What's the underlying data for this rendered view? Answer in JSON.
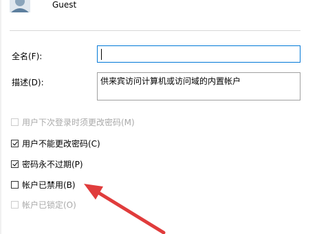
{
  "user": {
    "name": "Guest",
    "avatar_icon": "user-avatar-icon"
  },
  "form": {
    "fullname_label": "全名(F):",
    "fullname_value": "",
    "description_label": "描述(D):",
    "description_value": "供来宾访问计算机或访问域的内置帐户"
  },
  "options": [
    {
      "label": "用户下次登录时须更改密码(M)",
      "checked": false,
      "enabled": false
    },
    {
      "label": "用户不能更改密码(C)",
      "checked": true,
      "enabled": true
    },
    {
      "label": "密码永不过期(P)",
      "checked": true,
      "enabled": true
    },
    {
      "label": "帐户已禁用(B)",
      "checked": false,
      "enabled": true
    },
    {
      "label": "帐户已锁定(O)",
      "checked": false,
      "enabled": false
    }
  ],
  "colors": {
    "focus_border": "#0078d7",
    "annotation_arrow": "#e03c3c",
    "disabled_text": "#a9a9a9"
  }
}
